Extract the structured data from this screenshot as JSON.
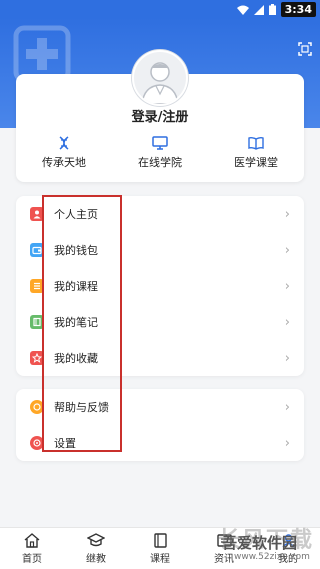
{
  "status": {
    "time": "3:34"
  },
  "profile": {
    "login_label": "登录/注册"
  },
  "quick_links": [
    {
      "label": "传承天地",
      "icon": "dna-icon"
    },
    {
      "label": "在线学院",
      "icon": "monitor-icon"
    },
    {
      "label": "医学课堂",
      "icon": "book-icon"
    }
  ],
  "menu_group1": [
    {
      "label": "个人主页",
      "color": "#ef5350"
    },
    {
      "label": "我的钱包",
      "color": "#42a5f5"
    },
    {
      "label": "我的课程",
      "color": "#ffa726"
    },
    {
      "label": "我的笔记",
      "color": "#66bb6a"
    },
    {
      "label": "我的收藏",
      "color": "#ef5350"
    }
  ],
  "menu_group2": [
    {
      "label": "帮助与反馈",
      "color": "#ffa726"
    },
    {
      "label": "设置",
      "color": "#ef5350"
    }
  ],
  "bottom_nav": [
    {
      "label": "首页",
      "icon": "home-icon"
    },
    {
      "label": "继教",
      "icon": "graduation-cap-icon"
    },
    {
      "label": "课程",
      "icon": "course-icon"
    },
    {
      "label": "资讯",
      "icon": "news-icon"
    },
    {
      "label": "我的",
      "icon": "profile-icon"
    }
  ],
  "watermark": {
    "big": "长风下载",
    "main": "吾爱软件园",
    "url": "www.52zixu.com"
  },
  "colors": {
    "primary": "#2f6fe0",
    "annotation_box": "#c9302c"
  }
}
